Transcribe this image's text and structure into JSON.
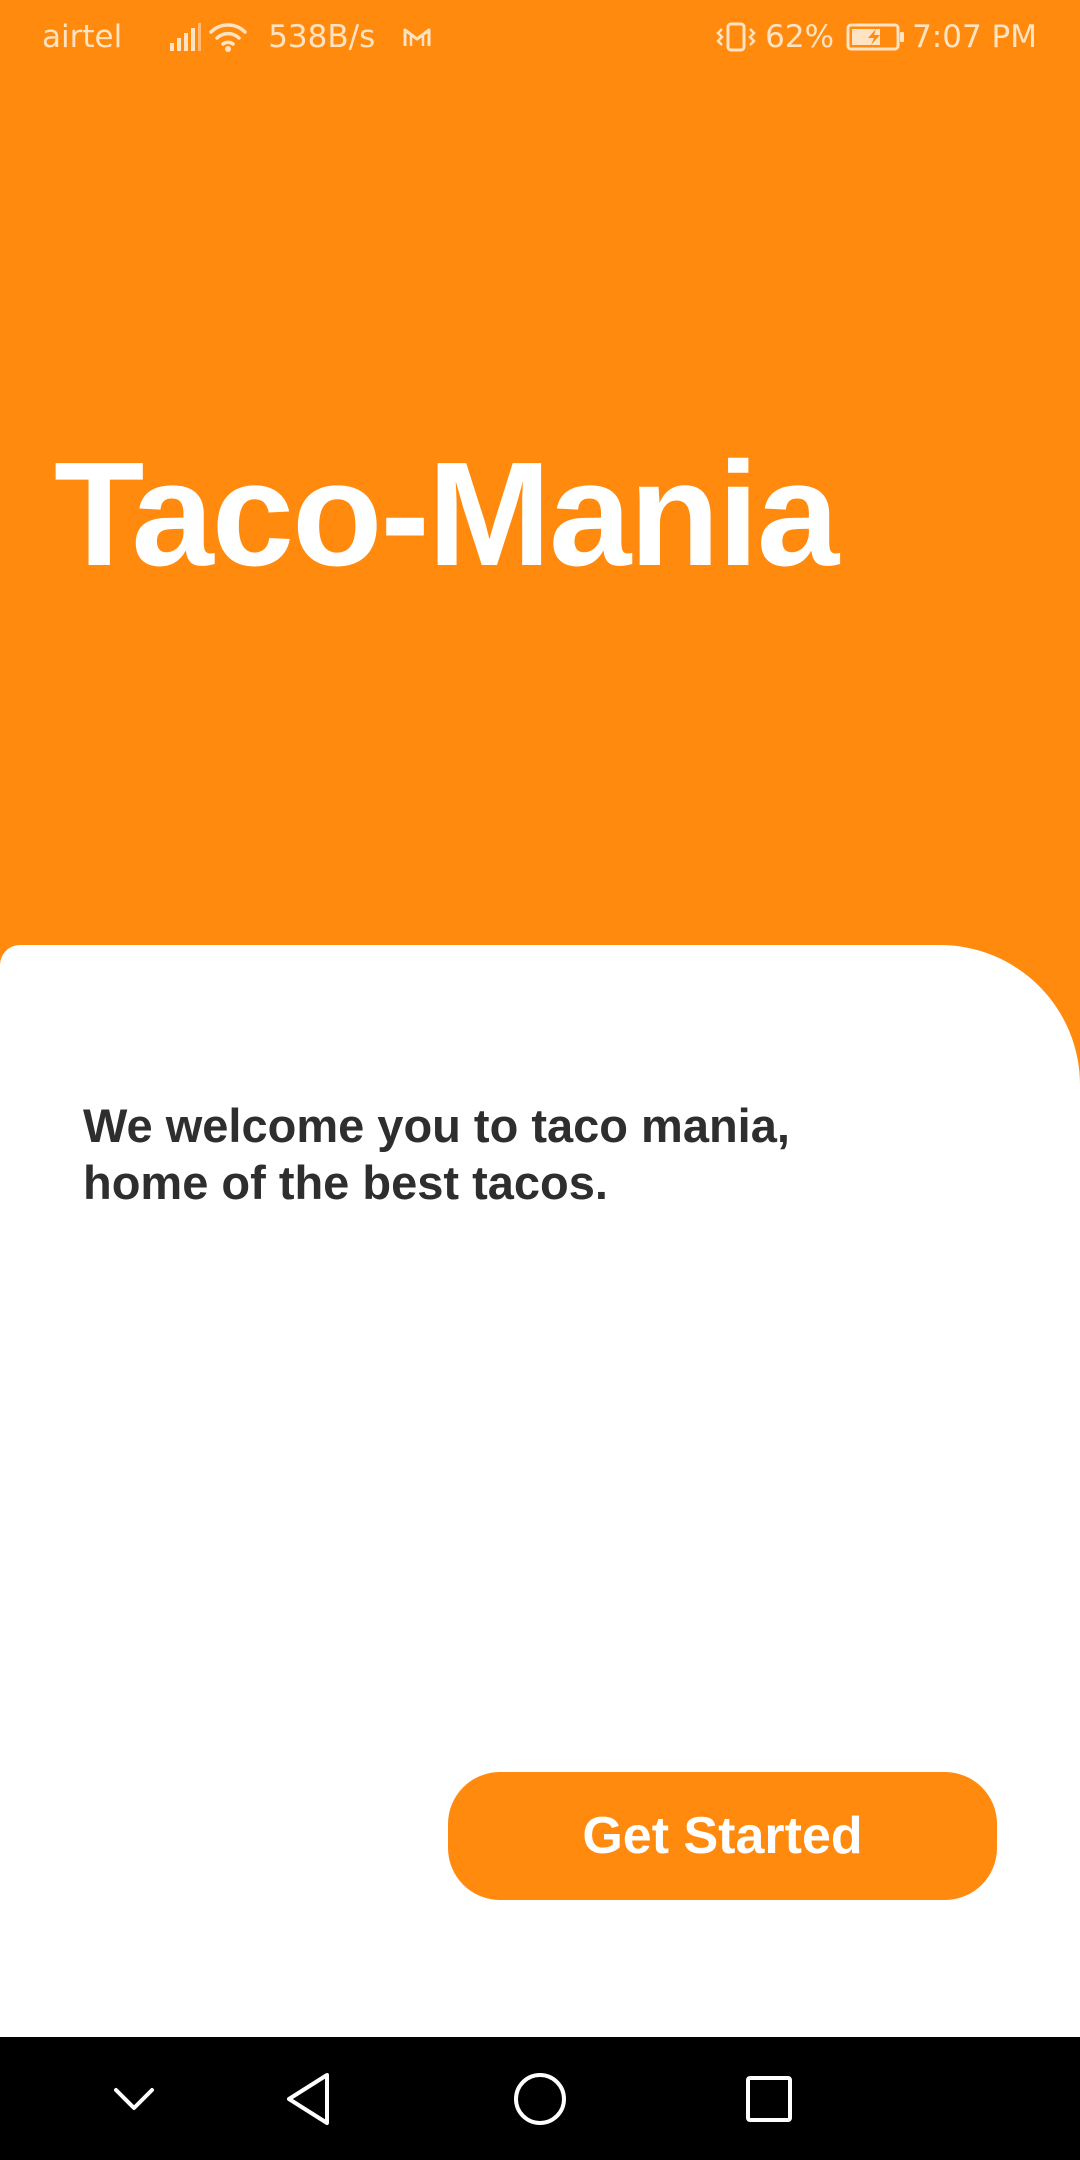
{
  "status_bar": {
    "carrier": "airtel",
    "network_speed": "538B/s",
    "battery_percent": "62%",
    "time": "7:07 PM",
    "icons": [
      "signal-icon",
      "wifi-icon",
      "gmail-icon",
      "vibrate-icon",
      "battery-charging-icon"
    ]
  },
  "header": {
    "title": "Taco-Mania"
  },
  "card": {
    "welcome_line1": "We welcome you to taco mania,",
    "welcome_line2": "home of the best tacos.",
    "cta_label": "Get Started"
  },
  "nav_bar": {
    "buttons": [
      "collapse-icon",
      "back-icon",
      "home-icon",
      "recents-icon"
    ]
  },
  "colors": {
    "accent": "#FF8A0E",
    "card_background": "#FFFFFF",
    "text_dark": "#2E2E2E",
    "nav_background": "#000000"
  }
}
